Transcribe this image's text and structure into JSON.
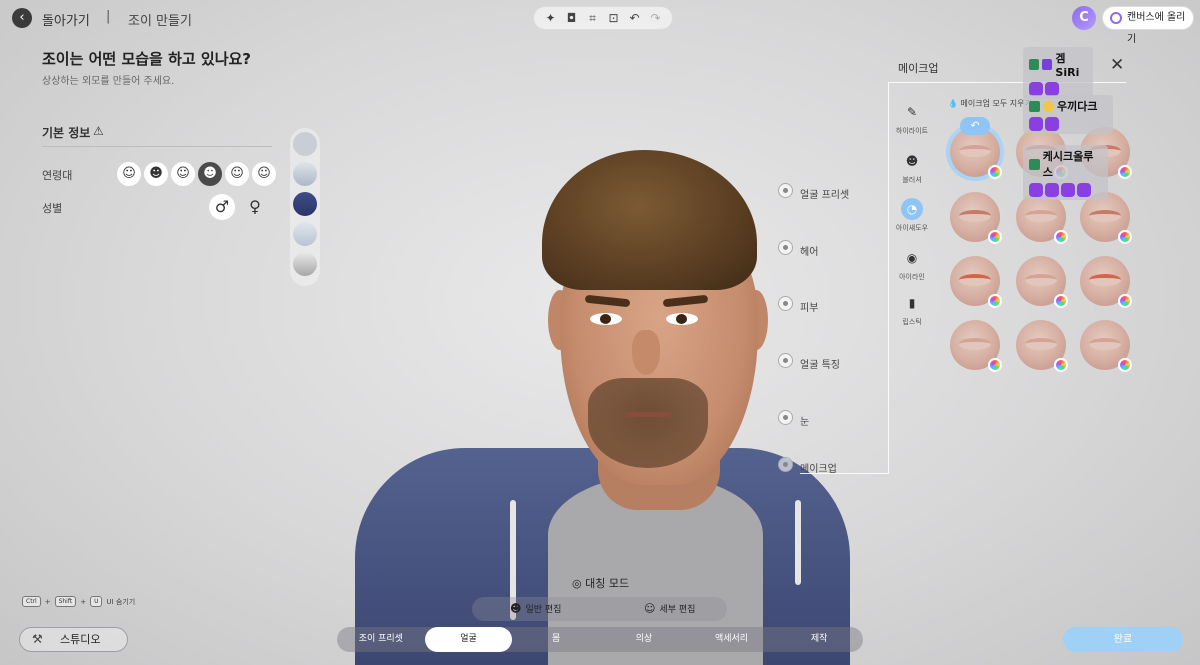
{
  "header": {
    "back_label": "돌아가기",
    "separator": "|",
    "page_title": "조이 만들기",
    "toolbar_icons": [
      "sparkle-icon",
      "camera-icon",
      "focus-icon",
      "face-scan-icon",
      "undo-icon",
      "redo-icon"
    ],
    "avatar_letter": "C",
    "upload_label": "캔버스에 올리기"
  },
  "intro": {
    "title": "조이는 어떤 모습을 하고 있나요?",
    "subtitle": "상상하는 외모를 만들어 주세요."
  },
  "basic_info": {
    "title": "기본 정보",
    "age_label": "연령대",
    "gender_label": "성별",
    "age_selected_index": 3,
    "gender_male": "♂",
    "gender_female": "♀"
  },
  "categories": [
    "얼굴 프리셋",
    "헤어",
    "피부",
    "얼굴 특징",
    "눈",
    "메이크업"
  ],
  "makeup": {
    "title": "메이크업",
    "clear_all": "메이크업 모두 지우기",
    "subcategories": [
      {
        "label": "하이라이트",
        "icon": "brush-icon"
      },
      {
        "label": "블러셔",
        "icon": "face-icon"
      },
      {
        "label": "아이섀도우",
        "icon": "eyeshadow-icon"
      },
      {
        "label": "아이라인",
        "icon": "eyeliner-icon"
      },
      {
        "label": "립스틱",
        "icon": "lipstick-icon"
      }
    ],
    "selected_subcategory": 2
  },
  "chat": [
    {
      "name": "겜SiRi",
      "stickers": 2
    },
    {
      "name": "우끼다크",
      "stickers": 2
    },
    {
      "name": "케시크올루스",
      "stickers": 4
    }
  ],
  "hotkeys": {
    "key1": "Ctrl",
    "plus": "+",
    "key2": "Shift",
    "key3": "U",
    "action": "UI 숨기기"
  },
  "studio_label": "스튜디오",
  "mirror_mode_label": "대칭 모드",
  "edit_modes": {
    "normal": "일반 편집",
    "detail": "세부 편집"
  },
  "tabs": [
    "조이 프리셋",
    "얼굴",
    "몸",
    "의상",
    "액세서리",
    "제작"
  ],
  "selected_tab": 1,
  "done_label": "완료",
  "colors": {
    "accent": "#8ec5f5",
    "done": "#9fd0f5",
    "avatar": "#8a6cf0"
  }
}
